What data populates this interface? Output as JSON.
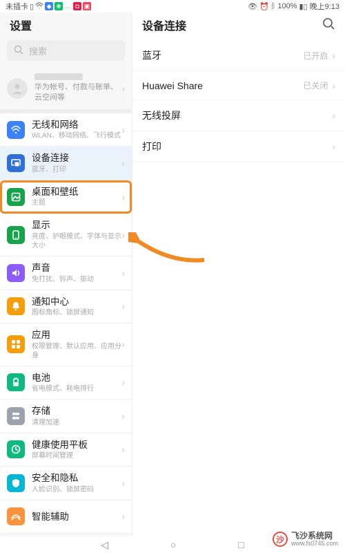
{
  "status": {
    "left_text": "未插卡",
    "battery": "100%",
    "time": "晚上9:13"
  },
  "left_pane": {
    "title": "设置",
    "search_placeholder": "搜索",
    "account_sub": "华为帐号、付款与账单、云空间等",
    "items": [
      {
        "title": "无线和网络",
        "sub": "WLAN、移动网络、飞行模式",
        "icon_bg": "#3b82f6",
        "icon": "wifi",
        "selected": false
      },
      {
        "title": "设备连接",
        "sub": "蓝牙、打印",
        "icon_bg": "#2f6fd6",
        "icon": "device",
        "selected": true
      },
      {
        "title": "桌面和壁纸",
        "sub": "主题",
        "icon_bg": "#16a34a",
        "icon": "wallpaper",
        "highlight": true
      },
      {
        "title": "显示",
        "sub": "亮度、护眼模式、字体与显示大小",
        "icon_bg": "#16a34a",
        "icon": "display"
      },
      {
        "title": "声音",
        "sub": "免打扰、铃声、振动",
        "icon_bg": "#8b5cf6",
        "icon": "sound"
      },
      {
        "title": "通知中心",
        "sub": "图标角标、锁屏通知",
        "icon_bg": "#f59e0b",
        "icon": "notify"
      },
      {
        "title": "应用",
        "sub": "权限管理、默认应用、应用分身",
        "icon_bg": "#f59e0b",
        "icon": "apps"
      },
      {
        "title": "电池",
        "sub": "省电模式、耗电排行",
        "icon_bg": "#10b981",
        "icon": "battery"
      },
      {
        "title": "存储",
        "sub": "清理加速",
        "icon_bg": "#9ca3af",
        "icon": "storage"
      },
      {
        "title": "健康使用平板",
        "sub": "屏幕时间管理",
        "icon_bg": "#10b981",
        "icon": "health"
      },
      {
        "title": "安全和隐私",
        "sub": "人脸识别、锁屏密码",
        "icon_bg": "#06b6d4",
        "icon": "security"
      },
      {
        "title": "智能辅助",
        "sub": "",
        "icon_bg": "#fb923c",
        "icon": "assist"
      }
    ]
  },
  "right_pane": {
    "title": "设备连接",
    "items": [
      {
        "label": "蓝牙",
        "value": "已开启"
      },
      {
        "label": "Huawei Share",
        "value": "已关闭"
      },
      {
        "label": "无线投屏",
        "value": ""
      },
      {
        "label": "打印",
        "value": ""
      }
    ]
  },
  "watermark": {
    "brand": "飞沙系统网",
    "url": "www.fs0745.com"
  }
}
